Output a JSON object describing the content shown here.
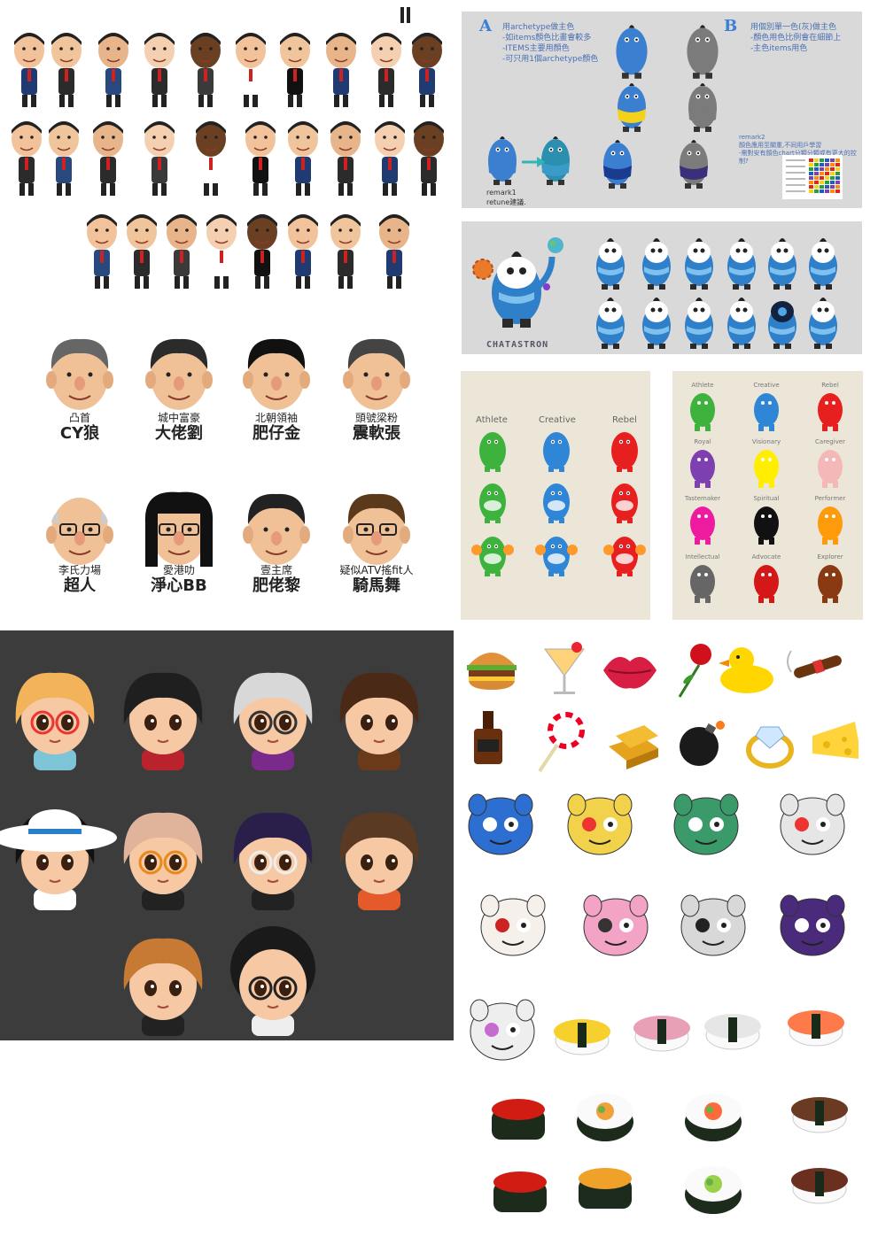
{
  "politician_captions": [
    {
      "sub": "凸首",
      "big": "CY狼"
    },
    {
      "sub": "城中富豪",
      "big": "大佬劉"
    },
    {
      "sub": "北朝領袖",
      "big": "肥仔金"
    },
    {
      "sub": "頭號梁粉",
      "big": "震軟張"
    },
    {
      "sub": "李氏力場",
      "big": "超人"
    },
    {
      "sub": "愛港叻",
      "big": "淨心BB"
    },
    {
      "sub": "壹主席",
      "big": "肥佬黎"
    },
    {
      "sub": "疑似ATV搖fit人",
      "big": "騎馬舞"
    }
  ],
  "palette_panel": {
    "step_a": "A",
    "note_a": [
      "用archetype做主色",
      "-如items顏色比畫會較多",
      "-ITEMS主要用顏色",
      "-可只用1個archetype顏色"
    ],
    "step_b": "B",
    "note_b": [
      "用個別單一色(灰)做主色",
      "-顏色用色比例會在細節上",
      "-主色items用色"
    ],
    "remark1": "remark1",
    "remark1_sub": "retune建議.",
    "remark2": "remark2",
    "remark2_text": [
      "顏色應用至關重,不同用戶學習",
      "-需對安有顏色chart分類分類或有更大的控制?"
    ]
  },
  "mascot_name": "CHATASTRON",
  "archetype_small": {
    "columns": [
      "Athlete",
      "Creative",
      "Rebel"
    ]
  },
  "archetype_grid": [
    {
      "name": "Athlete",
      "color": "#3db23d"
    },
    {
      "name": "Creative",
      "color": "#2f86d6"
    },
    {
      "name": "Rebel",
      "color": "#e81f1f"
    },
    {
      "name": "Royal",
      "color": "#7e3fb0"
    },
    {
      "name": "Visionary",
      "color": "#ffee00"
    },
    {
      "name": "Caregiver",
      "color": "#f5b8b8"
    },
    {
      "name": "Tastemaker",
      "color": "#ee1ba0"
    },
    {
      "name": "Spiritual",
      "color": "#111111"
    },
    {
      "name": "Performer",
      "color": "#ff9a0a"
    },
    {
      "name": "Intellectual",
      "color": "#666666"
    },
    {
      "name": "Advocate",
      "color": "#d41818"
    },
    {
      "name": "Explorer",
      "color": "#8a3a12"
    }
  ],
  "colors": {
    "gray_panel": "#d9d9d9",
    "beige_panel": "#ece6d8",
    "dark_panel": "#3c3c3c",
    "blob_blue": "#3a7fd0",
    "blob_gray": "#7b7b7b",
    "yellow": "#f5d21a"
  }
}
